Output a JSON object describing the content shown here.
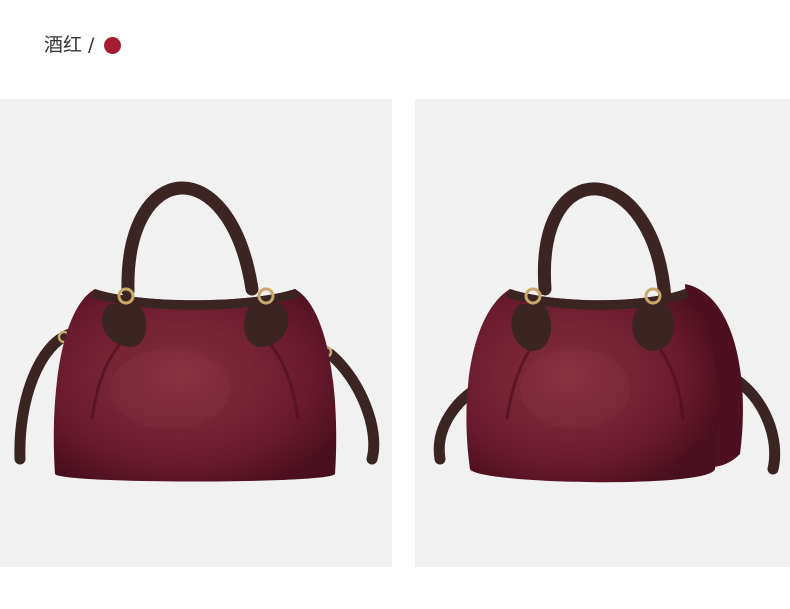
{
  "header": {
    "color_name": "酒红",
    "separator": "/"
  },
  "colors": {
    "swatch": "#a51c30",
    "bag_body": "#6a1a2e",
    "bag_shade": "#4e1020",
    "bag_highlight": "#86303f",
    "handle": "#3b2522",
    "hardware": "#c9a86a",
    "panel_bg": "#f1f1f1"
  },
  "images": [
    {
      "name": "bag-front-view",
      "icon": "handbag-front"
    },
    {
      "name": "bag-angle-view",
      "icon": "handbag-angle"
    }
  ]
}
